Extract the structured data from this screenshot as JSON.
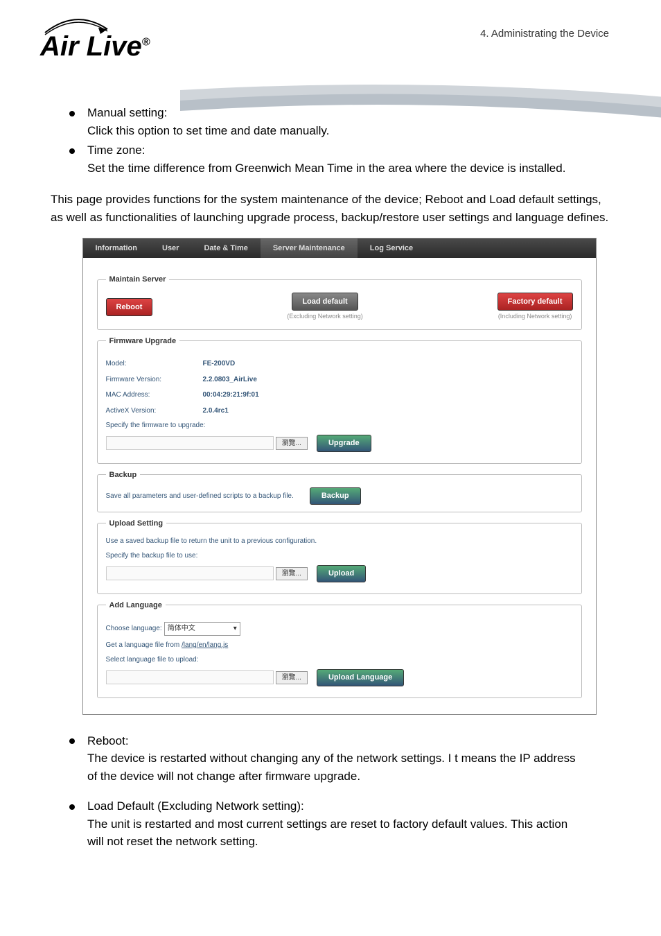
{
  "chapter": "4.  Administrating  the  Device",
  "logo": "Air Live",
  "bullets1": [
    {
      "title": "Manual setting:",
      "body": "Click this option to set time and date manually."
    },
    {
      "title": "Time zone:",
      "body": "Set the time difference from Greenwich Mean Time in the area where the device is installed."
    }
  ],
  "intro": "This page provides functions for the system maintenance of the device; Reboot and Load default settings, as well as functionalities of launching upgrade process, backup/restore user settings and language defines.",
  "ui": {
    "tabs": [
      "Information",
      "User",
      "Date & Time",
      "Server Maintenance",
      "Log Service"
    ],
    "maintain": {
      "legend": "Maintain Server",
      "reboot": "Reboot",
      "load": "Load default",
      "load_cap": "(Excluding Network setting)",
      "factory": "Factory default",
      "factory_cap": "(Including Network setting)"
    },
    "firmware": {
      "legend": "Firmware Upgrade",
      "model_l": "Model:",
      "model_v": "FE-200VD",
      "ver_l": "Firmware Version:",
      "ver_v": "2.2.0803_AirLive",
      "mac_l": "MAC Address:",
      "mac_v": "00:04:29:21:9f:01",
      "ax_l": "ActiveX Version:",
      "ax_v": "2.0.4rc1",
      "spec": "Specify the firmware to upgrade:",
      "browse": "瀏覽...",
      "upgrade": "Upgrade"
    },
    "backup": {
      "legend": "Backup",
      "text": "Save all parameters and user-defined scripts to a backup file.",
      "btn": "Backup"
    },
    "upload": {
      "legend": "Upload Setting",
      "text": "Use a saved backup file to return the unit to a previous configuration.",
      "spec": "Specify the backup file to use:",
      "browse": "瀏覽...",
      "btn": "Upload"
    },
    "lang": {
      "legend": "Add Language",
      "choose": "Choose language:",
      "sel": "简体中文",
      "get": "Get a language file from ",
      "link": "/lang/en/lang.js",
      "spec": "Select language file to upload:",
      "browse": "瀏覽...",
      "btn": "Upload Language"
    }
  },
  "bullets2": [
    {
      "title": "Reboot:",
      "body": "The device is restarted without changing any of the network settings. I t means the IP address of the device will not change after firmware upgrade."
    },
    {
      "title": "Load Default (Excluding Network setting):",
      "body": "The unit is restarted and most current settings are reset to factory default values. This action will not reset the network setting."
    }
  ]
}
